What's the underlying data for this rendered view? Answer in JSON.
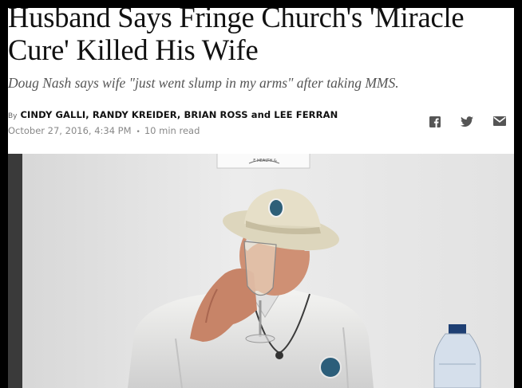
{
  "article": {
    "headline": "Husband Says Fringe Church's 'Miracle Cure' Killed His Wife",
    "subhead": "Doug Nash says wife \"just went slump in my arms\" after taking MMS.",
    "byline_prefix": "By",
    "authors": "CINDY GALLI, RANDY KREIDER, BRIAN ROSS and LEE FERRAN",
    "date": "October 27, 2016, 4:34 PM",
    "separator": "•",
    "read_time": "10 min read"
  },
  "share": {
    "icons": [
      "facebook-icon",
      "twitter-icon",
      "email-icon"
    ]
  },
  "photo": {
    "sign_text": "E HEALTH &"
  },
  "colors": {
    "headline": "#111111",
    "subhead": "#555555",
    "meta": "#888888",
    "icons": "#555555"
  }
}
